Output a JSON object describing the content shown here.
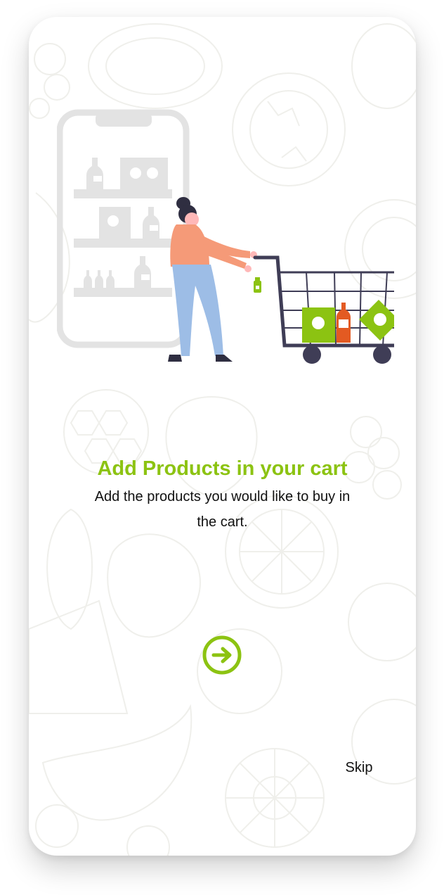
{
  "onboarding": {
    "title": "Add Products in your cart",
    "subtitle": "Add the products you would like to buy in the cart.",
    "skip_label": "Skip"
  },
  "colors": {
    "accent": "#8cc312",
    "pattern": "#eeeeea",
    "illustration_grey": "#e3e3e3",
    "person_top": "#f59a78",
    "person_pants": "#9dbde6",
    "cart_frame": "#3f3d56",
    "ketchup": "#e35a22"
  },
  "icons": {
    "next": "arrow-right-circle-icon"
  }
}
